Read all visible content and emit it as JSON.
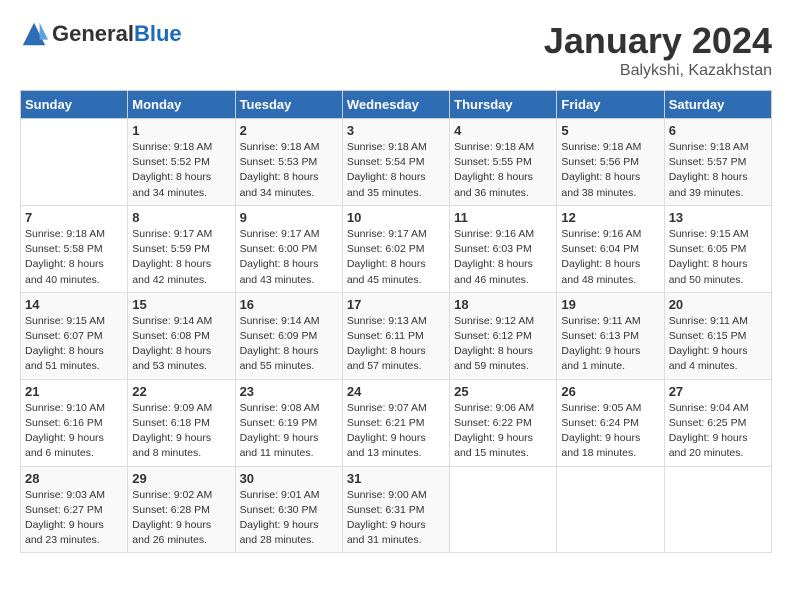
{
  "header": {
    "logo_general": "General",
    "logo_blue": "Blue",
    "month": "January 2024",
    "location": "Balykshi, Kazakhstan"
  },
  "weekdays": [
    "Sunday",
    "Monday",
    "Tuesday",
    "Wednesday",
    "Thursday",
    "Friday",
    "Saturday"
  ],
  "weeks": [
    [
      {
        "day": "",
        "sunrise": "",
        "sunset": "",
        "daylight": ""
      },
      {
        "day": "1",
        "sunrise": "9:18 AM",
        "sunset": "5:52 PM",
        "daylight": "8 hours and 34 minutes."
      },
      {
        "day": "2",
        "sunrise": "9:18 AM",
        "sunset": "5:53 PM",
        "daylight": "8 hours and 34 minutes."
      },
      {
        "day": "3",
        "sunrise": "9:18 AM",
        "sunset": "5:54 PM",
        "daylight": "8 hours and 35 minutes."
      },
      {
        "day": "4",
        "sunrise": "9:18 AM",
        "sunset": "5:55 PM",
        "daylight": "8 hours and 36 minutes."
      },
      {
        "day": "5",
        "sunrise": "9:18 AM",
        "sunset": "5:56 PM",
        "daylight": "8 hours and 38 minutes."
      },
      {
        "day": "6",
        "sunrise": "9:18 AM",
        "sunset": "5:57 PM",
        "daylight": "8 hours and 39 minutes."
      }
    ],
    [
      {
        "day": "7",
        "sunrise": "9:18 AM",
        "sunset": "5:58 PM",
        "daylight": "8 hours and 40 minutes."
      },
      {
        "day": "8",
        "sunrise": "9:17 AM",
        "sunset": "5:59 PM",
        "daylight": "8 hours and 42 minutes."
      },
      {
        "day": "9",
        "sunrise": "9:17 AM",
        "sunset": "6:00 PM",
        "daylight": "8 hours and 43 minutes."
      },
      {
        "day": "10",
        "sunrise": "9:17 AM",
        "sunset": "6:02 PM",
        "daylight": "8 hours and 45 minutes."
      },
      {
        "day": "11",
        "sunrise": "9:16 AM",
        "sunset": "6:03 PM",
        "daylight": "8 hours and 46 minutes."
      },
      {
        "day": "12",
        "sunrise": "9:16 AM",
        "sunset": "6:04 PM",
        "daylight": "8 hours and 48 minutes."
      },
      {
        "day": "13",
        "sunrise": "9:15 AM",
        "sunset": "6:05 PM",
        "daylight": "8 hours and 50 minutes."
      }
    ],
    [
      {
        "day": "14",
        "sunrise": "9:15 AM",
        "sunset": "6:07 PM",
        "daylight": "8 hours and 51 minutes."
      },
      {
        "day": "15",
        "sunrise": "9:14 AM",
        "sunset": "6:08 PM",
        "daylight": "8 hours and 53 minutes."
      },
      {
        "day": "16",
        "sunrise": "9:14 AM",
        "sunset": "6:09 PM",
        "daylight": "8 hours and 55 minutes."
      },
      {
        "day": "17",
        "sunrise": "9:13 AM",
        "sunset": "6:11 PM",
        "daylight": "8 hours and 57 minutes."
      },
      {
        "day": "18",
        "sunrise": "9:12 AM",
        "sunset": "6:12 PM",
        "daylight": "8 hours and 59 minutes."
      },
      {
        "day": "19",
        "sunrise": "9:11 AM",
        "sunset": "6:13 PM",
        "daylight": "9 hours and 1 minute."
      },
      {
        "day": "20",
        "sunrise": "9:11 AM",
        "sunset": "6:15 PM",
        "daylight": "9 hours and 4 minutes."
      }
    ],
    [
      {
        "day": "21",
        "sunrise": "9:10 AM",
        "sunset": "6:16 PM",
        "daylight": "9 hours and 6 minutes."
      },
      {
        "day": "22",
        "sunrise": "9:09 AM",
        "sunset": "6:18 PM",
        "daylight": "9 hours and 8 minutes."
      },
      {
        "day": "23",
        "sunrise": "9:08 AM",
        "sunset": "6:19 PM",
        "daylight": "9 hours and 11 minutes."
      },
      {
        "day": "24",
        "sunrise": "9:07 AM",
        "sunset": "6:21 PM",
        "daylight": "9 hours and 13 minutes."
      },
      {
        "day": "25",
        "sunrise": "9:06 AM",
        "sunset": "6:22 PM",
        "daylight": "9 hours and 15 minutes."
      },
      {
        "day": "26",
        "sunrise": "9:05 AM",
        "sunset": "6:24 PM",
        "daylight": "9 hours and 18 minutes."
      },
      {
        "day": "27",
        "sunrise": "9:04 AM",
        "sunset": "6:25 PM",
        "daylight": "9 hours and 20 minutes."
      }
    ],
    [
      {
        "day": "28",
        "sunrise": "9:03 AM",
        "sunset": "6:27 PM",
        "daylight": "9 hours and 23 minutes."
      },
      {
        "day": "29",
        "sunrise": "9:02 AM",
        "sunset": "6:28 PM",
        "daylight": "9 hours and 26 minutes."
      },
      {
        "day": "30",
        "sunrise": "9:01 AM",
        "sunset": "6:30 PM",
        "daylight": "9 hours and 28 minutes."
      },
      {
        "day": "31",
        "sunrise": "9:00 AM",
        "sunset": "6:31 PM",
        "daylight": "9 hours and 31 minutes."
      },
      {
        "day": "",
        "sunrise": "",
        "sunset": "",
        "daylight": ""
      },
      {
        "day": "",
        "sunrise": "",
        "sunset": "",
        "daylight": ""
      },
      {
        "day": "",
        "sunrise": "",
        "sunset": "",
        "daylight": ""
      }
    ]
  ]
}
